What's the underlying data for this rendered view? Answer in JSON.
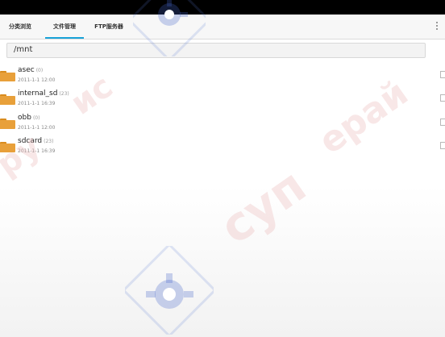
{
  "tabs": [
    {
      "label": "分类浏览",
      "active": false
    },
    {
      "label": "文件管理",
      "active": true
    },
    {
      "label": "FTP服务器",
      "active": false
    }
  ],
  "path": "/mnt",
  "files": [
    {
      "name": "asec",
      "count": "(0)",
      "date": "2011-1-1 12:00"
    },
    {
      "name": "internal_sd",
      "count": "(23)",
      "date": "2011-1-1 16:39"
    },
    {
      "name": "obb",
      "count": "(0)",
      "date": "2011-1-1 12:00"
    },
    {
      "name": "sdcard",
      "count": "(23)",
      "date": "2011-1-1 16:39"
    }
  ],
  "watermark": {
    "text_left": "ру",
    "text_center": "суп",
    "text_right": "epай",
    "text_top": "ис"
  },
  "colors": {
    "accent": "#1aa3d9",
    "folder": "#e8a03a",
    "status_bar": "#000000"
  },
  "icons": {
    "folder": "folder-icon",
    "overflow": "overflow-menu-icon",
    "checkbox": "checkbox-icon"
  }
}
